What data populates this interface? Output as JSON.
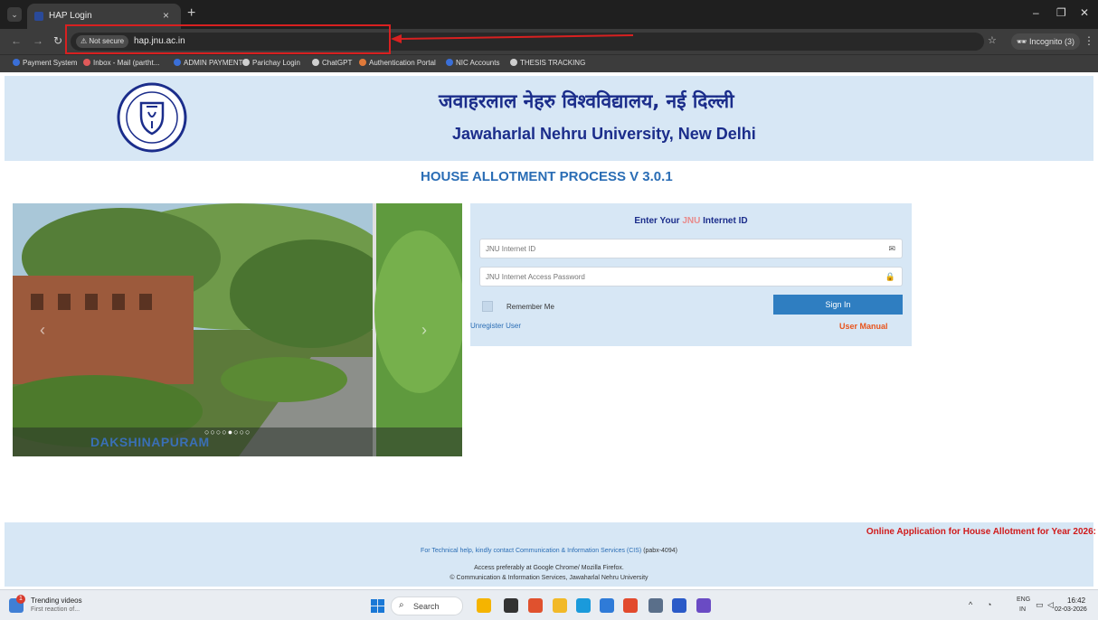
{
  "browser": {
    "tab_title": "HAP Login",
    "security_label": "Not secure",
    "url": "hap.jnu.ac.in",
    "incognito_label": "Incognito (3)",
    "bookmarks": [
      {
        "label": "Payment System",
        "color": "#3a6fd8"
      },
      {
        "label": "Inbox - Mail (partht...",
        "color": "#e05a5a"
      },
      {
        "label": "ADMIN PAYMENT",
        "color": "#3a6fd8"
      },
      {
        "label": "Parichay Login",
        "color": "#cfcfcf"
      },
      {
        "label": "ChatGPT",
        "color": "#cfcfcf"
      },
      {
        "label": "Authentication Portal",
        "color": "#e07a3a"
      },
      {
        "label": "NIC Accounts",
        "color": "#3a6fd8"
      },
      {
        "label": "THESIS TRACKING",
        "color": "#cfcfcf"
      }
    ]
  },
  "header": {
    "hindi_title": "जवाहरलाल नेहरु विश्वविद्यालय, नई दिल्ली",
    "english_title": "Jawaharlal Nehru University, New Delhi",
    "process_title": "HOUSE ALLOTMENT PROCESS V 3.0.1"
  },
  "slider": {
    "caption": "DAKSHINAPURAM",
    "total_slides": 8,
    "active_slide": 5
  },
  "login": {
    "heading_prefix": "Enter Your ",
    "heading_highlight": "JNU",
    "heading_suffix": " Internet ID",
    "id_placeholder": "JNU Internet ID",
    "password_placeholder": "JNU Internet Access Password",
    "remember_label": "Remember Me",
    "signin_label": "Sign In",
    "unregister_label": "Unregister User",
    "manual_label": "User Manual"
  },
  "footer": {
    "online_notice": "Online Application for House Allotment for Year 2026:",
    "tech_help": "For Technical help, kindly contact Communication & Information Services (CIS)",
    "pabx": " (pabx-4094)",
    "browser_note": "Access preferably at Google Chrome/ Mozilla Firefox.",
    "copyright": "© Communication & Information Services, Jawaharlal Nehru University"
  },
  "taskbar": {
    "news_title": "Trending videos",
    "news_subtitle": "First reaction of...",
    "news_badge": "1",
    "search_label": "Search",
    "lang_top": "ENG",
    "lang_bottom": "IN",
    "time": "16:42",
    "date": "02-03-2026",
    "apps": [
      "#f5b400",
      "#333333",
      "#e0512e",
      "#f2b928",
      "#1a9adb",
      "#2f7bd8",
      "#e24a2d",
      "#5a6f8a",
      "#2a5ac8",
      "#6a4bc4"
    ]
  }
}
